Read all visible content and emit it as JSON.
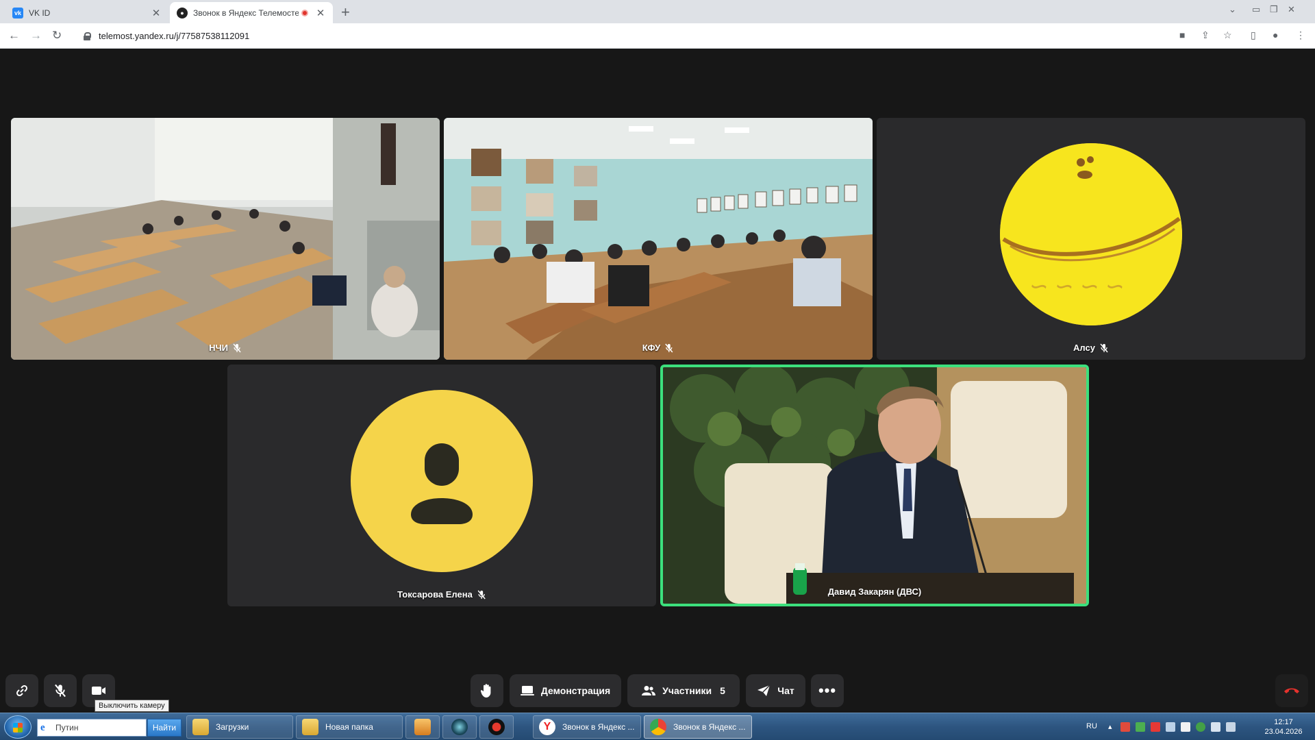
{
  "browser": {
    "tabs": [
      {
        "title": "VK ID",
        "favicon": "vk-icon"
      },
      {
        "title": "Звонок в Яндекс Телемосте",
        "favicon": "telemost-icon",
        "recording": true
      }
    ],
    "url": "telemost.yandex.ru/j/77587538112091"
  },
  "participants": [
    {
      "name": "НЧИ",
      "muted": true,
      "kind": "video-classroom"
    },
    {
      "name": "КФУ",
      "muted": true,
      "kind": "video-auditorium"
    },
    {
      "name": "Алсу",
      "muted": true,
      "kind": "avatar-image"
    },
    {
      "name": "Токсарова Елена",
      "muted": true,
      "kind": "avatar-placeholder"
    },
    {
      "name": "Давид Закарян (ДВС)",
      "muted": false,
      "kind": "video-speaker",
      "speaking": true
    }
  ],
  "controls": {
    "demonstration_label": "Демонстрация",
    "participants_label": "Участники",
    "participants_count": "5",
    "chat_label": "Чат",
    "camera_tooltip": "Выключить камеру"
  },
  "taskbar": {
    "search_value": "Путин",
    "search_button": "Найти",
    "items": [
      {
        "label": "Загрузки"
      },
      {
        "label": "Новая папка"
      },
      {
        "label": "Звонок в Яндекс ..."
      },
      {
        "label": "Звонок в Яндекс ..."
      }
    ],
    "lang": "RU",
    "time": "12:17",
    "date": "23.04.2026"
  },
  "colors": {
    "accent_active_speaker": "#3ce07d",
    "avatar_yellow": "#f5d44a",
    "record_red": "#e0332c"
  }
}
